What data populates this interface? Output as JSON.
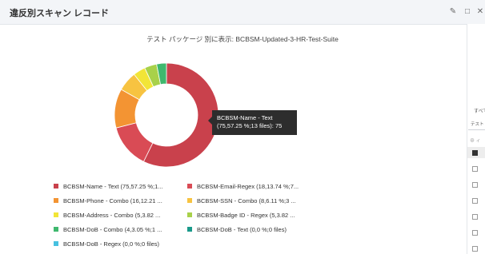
{
  "panel": {
    "title": "違反別スキャン レコード",
    "icons": [
      "pencil-icon",
      "maximize-icon",
      "close-icon"
    ],
    "edit_glyph": "✎",
    "maximize_glyph": "□",
    "close_glyph": "✕"
  },
  "chart_data": {
    "type": "pie",
    "title": "テスト パッケージ 別に表示: BCBSM-Updated-3-HR-Test-Suite",
    "slices": [
      {
        "label": "BCBSM-Name - Text (75,57.25 %;1...",
        "value": 75,
        "percent": 57.25,
        "color": "#c9414c"
      },
      {
        "label": "BCBSM-Email-Regex (18,13.74 %;7...",
        "value": 18,
        "percent": 13.74,
        "color": "#d94b55"
      },
      {
        "label": "BCBSM-Phone - Combo (16,12.21 ...",
        "value": 16,
        "percent": 12.21,
        "color": "#f39433"
      },
      {
        "label": "BCBSM-SSN - Combo (8,6.11 %;3 ...",
        "value": 8,
        "percent": 6.11,
        "color": "#f7c341"
      },
      {
        "label": "BCBSM-Address - Combo (5,3.82 ...",
        "value": 5,
        "percent": 3.82,
        "color": "#f2e537"
      },
      {
        "label": "BCBSM-Badge ID - Regex (5,3.82 ...",
        "value": 5,
        "percent": 3.82,
        "color": "#a8d14a"
      },
      {
        "label": "BCBSM-DoB - Combo (4,3.05 %;1 ...",
        "value": 4,
        "percent": 3.05,
        "color": "#3fb86e"
      },
      {
        "label": "BCBSM-DoB - Text (0,0 %;0 files)",
        "value": 0,
        "percent": 0,
        "color": "#1a9a8a"
      },
      {
        "label": "BCBSM-DoB - Regex (0,0 %;0 files)",
        "value": 0,
        "percent": 0,
        "color": "#47c1e0"
      }
    ],
    "tooltip": {
      "line1": "BCBSM-Name - Text",
      "line2": "(75,57.25 %;13 files): 75"
    },
    "legend_placement": "bottom"
  },
  "side_panel": {
    "label_all": "すべて",
    "tab_label": "テスト",
    "search_placeholder": "⊕ ィ"
  }
}
